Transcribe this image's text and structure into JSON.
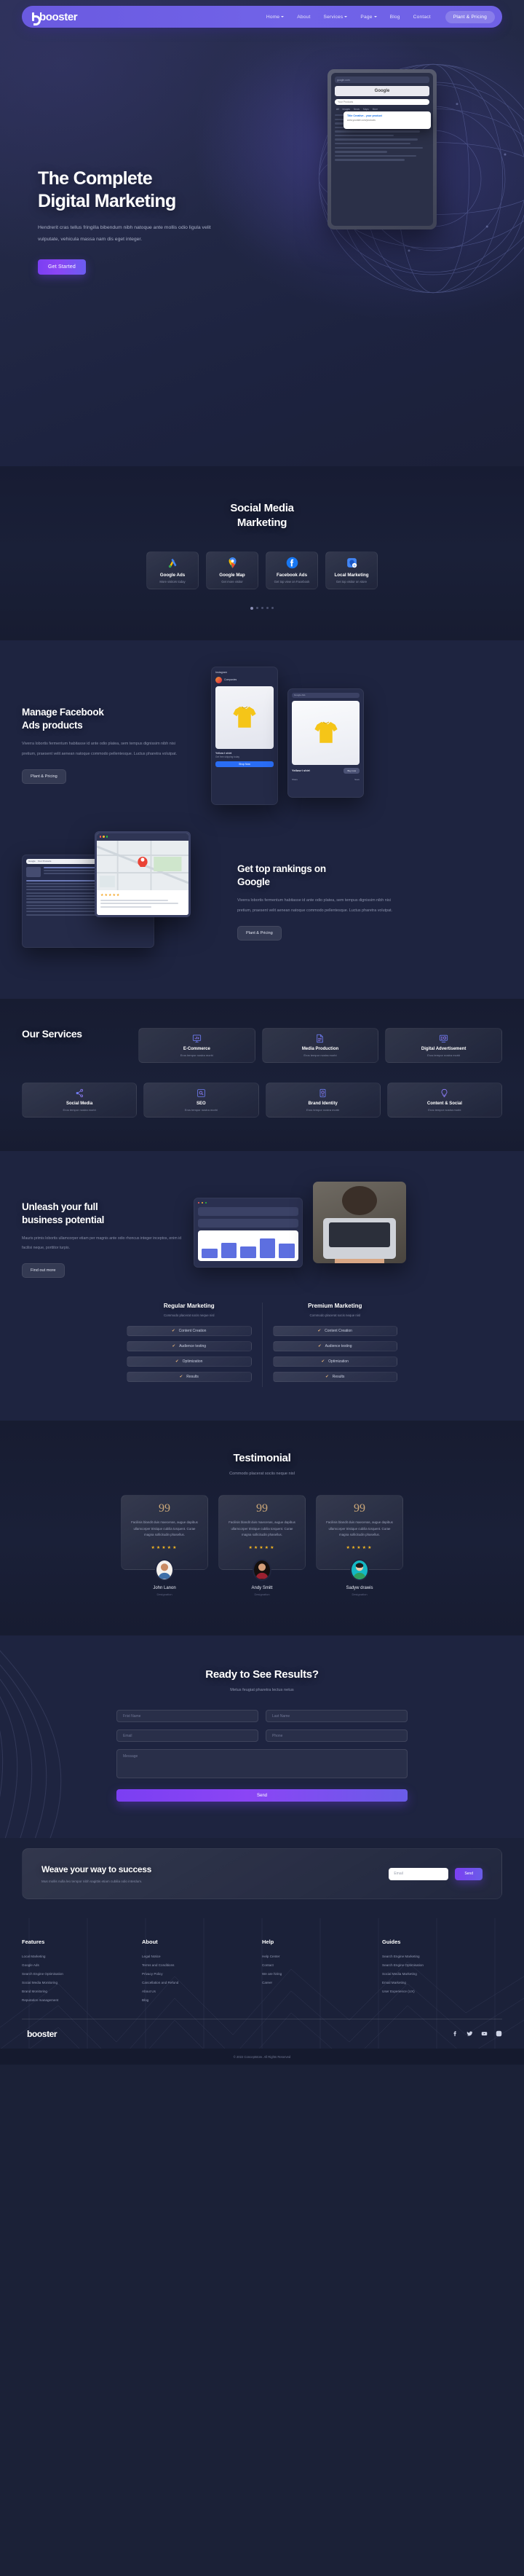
{
  "brand": {
    "name": "booster"
  },
  "nav": {
    "items": [
      {
        "label": "Home",
        "caret": true
      },
      {
        "label": "About",
        "caret": false
      },
      {
        "label": "Services",
        "caret": true
      },
      {
        "label": "Page",
        "caret": true
      },
      {
        "label": "Blog",
        "caret": false
      },
      {
        "label": "Contact",
        "caret": false
      }
    ],
    "cta": "Plant & Pricing"
  },
  "hero": {
    "title_line1": "The Complete",
    "title_line2": "Digital Marketing",
    "paragraph": "Hendrerit cras tellus fringilla bibendum nibh natoque ante mollis odio ligula velit vulputate, vehicula massa nam dis eget  integer.",
    "button": "Get Started",
    "mock": {
      "addressbar": "google.com",
      "engine": "Google",
      "search_placeholder": "Your Products",
      "tabs": [
        "All",
        "Images",
        "News",
        "Maps",
        "More"
      ],
      "result_title": "Title Creative - your product",
      "result_url": "www.yoursite.com/products"
    }
  },
  "social": {
    "title_line1": "Social Media",
    "title_line2": "Marketing",
    "cards": [
      {
        "icon": "google-ads-icon",
        "title": "Google Ads",
        "desc": "More visitors today"
      },
      {
        "icon": "google-map-icon",
        "title": "Google Map",
        "desc": "Get more visitor"
      },
      {
        "icon": "facebook-icon",
        "title": "Facebook Ads",
        "desc": "Get top view on Facebook"
      },
      {
        "icon": "local-marketing-icon",
        "title": "Local Marketing",
        "desc": "Get top visitor on store"
      }
    ],
    "dots": 5,
    "active_dot": 0
  },
  "facebook_section": {
    "title_line1": "Manage Facebook",
    "title_line2": "Ads products",
    "paragraph": "Viverra lobortis fermentum habitasse id ante odio platea, sem tempus dignissim nibh nisi pretium, praesent velit aenean natoque commodo pellentesque. Luctus pharetra volutpat.",
    "button": "Plant & Pricing",
    "instagram_mock": {
      "header": "Instagram",
      "profile": "Companies",
      "caption": "Yellow t shirt",
      "sub": "Get free shipping today",
      "cta": "Shop Now"
    },
    "shop_mock": {
      "title": "Google Ads",
      "product": "Yellow t shirt",
      "button": "Buy now",
      "footer_left": "Share",
      "footer_right": "Save"
    }
  },
  "google_section": {
    "title_line1": "Get top rankings on",
    "title_line2": "Google",
    "paragraph": "Viverra lobortis fermentum habitasse id ante odio platea, sem tempus dignissim nibh nisi pretium, praesent velit aenean natoque commodo pellentesque. Luctus pharetra volutpat.",
    "button": "Plant & Pricing",
    "search_mock": {
      "engine": "Google",
      "query": "Your Products",
      "result_label": "Your Company",
      "stars": "★★★★★"
    }
  },
  "services": {
    "title": "Our Services",
    "items": [
      {
        "icon": "monitor-chart-icon",
        "title": "E-Commerce",
        "desc": "Eros tempor nostra morbi"
      },
      {
        "icon": "media-file-icon",
        "title": "Media Production",
        "desc": "Eros tempor nostra morbi"
      },
      {
        "icon": "digital-ad-icon",
        "title": "Digital Advertisement",
        "desc": "Eros tempor nostra morbi"
      },
      {
        "icon": "share-nodes-icon",
        "title": "Social Media",
        "desc": "Eros tempor nostra morbi"
      },
      {
        "icon": "seo-search-icon",
        "title": "SEO",
        "desc": "Eros tempor nostra morbi"
      },
      {
        "icon": "brand-identity-icon",
        "title": "Brand Identity",
        "desc": "Eros tempor nostra morbi"
      },
      {
        "icon": "lightbulb-icon",
        "title": "Content & Social",
        "desc": "Eros tempor nostra morbi"
      }
    ]
  },
  "unleash": {
    "title_line1": "Unleash your full",
    "title_line2": "business potential",
    "paragraph": "Mauris primis lobortis ullamcorper etiam per magnis ante odio rhoncus integer inceptos, enim id facilisi neque, porttitor turpis.",
    "button": "Find out more",
    "chart": {
      "bars": [
        38,
        62,
        48,
        80,
        58
      ]
    }
  },
  "compare": {
    "columns": [
      {
        "title": "Regular Marketing",
        "subtitle": "Commodo placerat socis neque nisl",
        "rows": [
          "Content Creation",
          "Audience testing",
          "Optimization",
          "Results"
        ]
      },
      {
        "title": "Premium Marketing",
        "subtitle": "Commodo placerat socis neque nisl",
        "rows": [
          "Content Creation",
          "Audience testing",
          "Optimization",
          "Results"
        ]
      }
    ],
    "check_glyph": "✔"
  },
  "testimonial": {
    "title": "Testimonial",
    "subtitle": "Commodo placerat sociis neque nisl",
    "quote_glyph": "99",
    "stars": "★★★★★",
    "cards": [
      {
        "text": "Facilisis blandit duis maecenas, augue dapibus ullamcorper tristique cubilia torquent. Curae magna sollicitudin phasellus.",
        "name": "John Lanon",
        "role": "Designation"
      },
      {
        "text": "Facilisis blandit duis maecenas, augue dapibus ullamcorper tristique cubilia torquent. Curae magna sollicitudin phasellus.",
        "name": "Andy Smitt",
        "role": "Designation"
      },
      {
        "text": "Facilisis blandit duis maecenas, augue dapibus ullamcorper tristique cubilia torquent. Curae magna sollicitudin phasellus.",
        "name": "Sadyw drawis",
        "role": "Designation"
      }
    ]
  },
  "contact": {
    "title": "Ready to See Results?",
    "subtitle": "Metus feugiat pharetra lectus netus",
    "first_name_placeholder": "Frist Name",
    "last_name_placeholder": "Last Name",
    "email_placeholder": "Email",
    "phone_placeholder": "Phone",
    "message_placeholder": "Message",
    "send": "Send"
  },
  "newsletter": {
    "title": "Weave your way to success",
    "subtitle": "Mus mollis nulla leo tempor nibh sagittis etiam cubilia odio interdum.",
    "email_placeholder": "Email",
    "button": "Send"
  },
  "footer": {
    "columns": [
      {
        "heading": "Features",
        "links": [
          "Local Marketing",
          "Google Ads",
          "Search Engine Optimisation",
          "Social Media Monitoring",
          "Brand Monitoring",
          "Reputation management"
        ]
      },
      {
        "heading": "About",
        "links": [
          "Legal Notice",
          "Terms and Conditions",
          "Privacy Policy",
          "Cancellation and Refund",
          "About Us",
          "Blog"
        ]
      },
      {
        "heading": "Help",
        "links": [
          "Help Center",
          "Contact",
          "We are hiring",
          "Career"
        ]
      },
      {
        "heading": "Guides",
        "links": [
          "Search Engine Marketing",
          "Search Engine Optimisation",
          "Social Media Marketing",
          "Email Marketing",
          "User Experience (UX)"
        ]
      }
    ],
    "socials": [
      "facebook-icon",
      "twitter-icon",
      "youtube-icon",
      "instagram-icon"
    ],
    "copyright": "© 2022 Conceptstore. All Rights Reserved"
  },
  "colors": {
    "accent": "#6a5ae0",
    "gradient_start": "#7b3ff2",
    "gradient_end": "#6a5ce8",
    "page_bg": "#1e2440",
    "alt_bg": "#171c31"
  }
}
